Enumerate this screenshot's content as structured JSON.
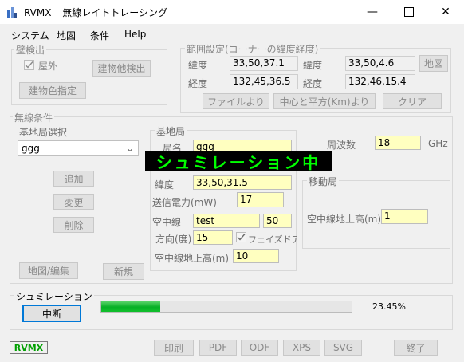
{
  "window": {
    "app_name": "RVMX",
    "title": "無線レイトトレーシング"
  },
  "menu": [
    "システム",
    "地図",
    "条件",
    "Help"
  ],
  "wall": {
    "label": "壁検出",
    "outdoor_label": "屋外",
    "outdoor_checked": true,
    "detect_button": "建物他検出",
    "color_button": "建物色指定"
  },
  "range": {
    "label": "範囲設定(コーナーの緯度経度)",
    "lat_label": "緯度",
    "lon_label": "経度",
    "lat1": "33,50,37.1",
    "lat2": "33,50,4.6",
    "lon1": "132,45,36.5",
    "lon2": "132,46,15.4",
    "map_button": "地図",
    "file_button": "ファイルより",
    "center_button": "中心と平方(Km)より",
    "clear_button": "クリア"
  },
  "radio": {
    "label": "無線条件",
    "station_select_label": "基地局選択",
    "station_value": "ggg",
    "add_button": "追加",
    "change_button": "変更",
    "delete_button": "削除",
    "map_edit_button": "地図/編集",
    "new_button": "新規"
  },
  "base": {
    "label": "基地局",
    "name_label": "局名",
    "name_value": "ggg",
    "lat_label": "緯度",
    "lat_value": "33,50,31.5",
    "power_label": "送信電力(mW)",
    "power_value": "17",
    "antenna_label": "空中線",
    "antenna_value": "test",
    "antenna_num": "50",
    "direction_label": "方向(度)",
    "direction_value": "15",
    "phased_label": "フェイズドアレイ",
    "phased_checked": true,
    "height_label": "空中線地上高(m)",
    "height_value": "10"
  },
  "freq": {
    "label": "周波数",
    "value": "18",
    "unit": "GHz"
  },
  "mobile": {
    "label": "移動局",
    "height_label": "空中線地上高(m)",
    "height_value": "1"
  },
  "simulation": {
    "banner": "シュミレーション中",
    "group_label": "シュミレーション",
    "stop_button": "中断",
    "progress_fraction": 0.2345,
    "progress_text": "23.45%"
  },
  "footer": {
    "logo": "RVMX",
    "print_button": "印刷",
    "pdf_button": "PDF",
    "odf_button": "ODF",
    "xps_button": "XPS",
    "svg_button": "SVG",
    "exit_button": "終了"
  },
  "colors": {
    "banner_text": "#00ff00",
    "progress": "#06b025",
    "field_yellow": "#ffffc0",
    "focus_blue": "#0078d7"
  }
}
